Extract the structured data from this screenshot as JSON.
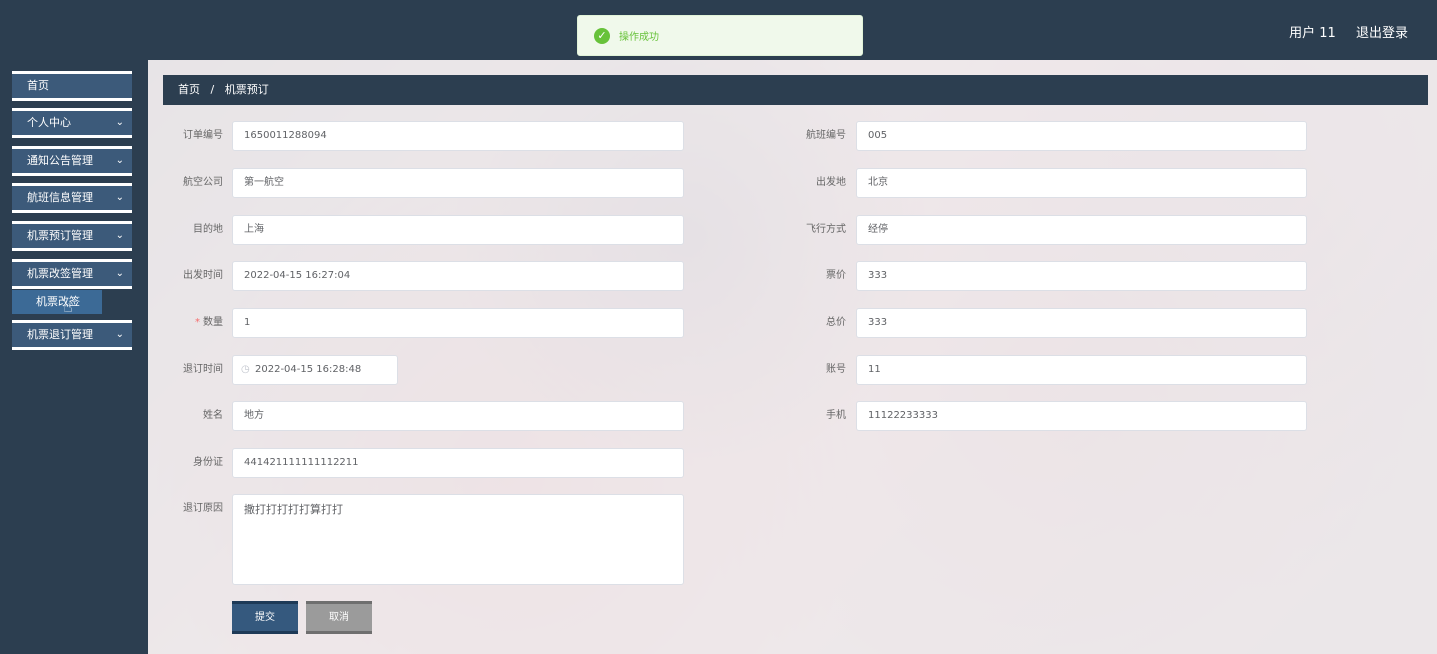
{
  "toast": {
    "icon": "check-circle-icon",
    "message": "操作成功",
    "color": "#67c23a"
  },
  "header": {
    "user": "用户 11",
    "logout": "退出登录"
  },
  "sidebar": {
    "items": [
      {
        "label": "首页"
      },
      {
        "label": "个人中心"
      },
      {
        "label": "通知公告管理"
      },
      {
        "label": "航班信息管理"
      },
      {
        "label": "机票预订管理"
      },
      {
        "label": "机票改签管理"
      },
      {
        "label": "机票退订管理"
      }
    ],
    "submenu": {
      "label": "机票改签"
    }
  },
  "breadcrumb": {
    "home": "首页",
    "separator": "/",
    "current": "机票预订"
  },
  "form": {
    "order_no": {
      "label": "订单编号",
      "value": "1650011288094"
    },
    "flight_no": {
      "label": "航班编号",
      "value": "005"
    },
    "airline": {
      "label": "航空公司",
      "value": "第一航空"
    },
    "departure": {
      "label": "出发地",
      "value": "北京"
    },
    "destination": {
      "label": "目的地",
      "value": "上海"
    },
    "flight_mode": {
      "label": "飞行方式",
      "value": "经停"
    },
    "depart_time": {
      "label": "出发时间",
      "value": "2022-04-15 16:27:04"
    },
    "price": {
      "label": "票价",
      "value": "333"
    },
    "quantity": {
      "label": "数量",
      "required_mark": "*",
      "value": "1"
    },
    "total": {
      "label": "总价",
      "value": "333"
    },
    "cancel_time": {
      "label": "退订时间",
      "value": "2022-04-15 16:28:48"
    },
    "account": {
      "label": "账号",
      "value": "11"
    },
    "name": {
      "label": "姓名",
      "value": "地方"
    },
    "phone": {
      "label": "手机",
      "value": "11122233333"
    },
    "id_card": {
      "label": "身份证",
      "value": "441421111111112211"
    },
    "reason": {
      "label": "退订原因",
      "value": "撒打打打打打算打打"
    }
  },
  "buttons": {
    "submit": "提交",
    "cancel": "取消"
  }
}
